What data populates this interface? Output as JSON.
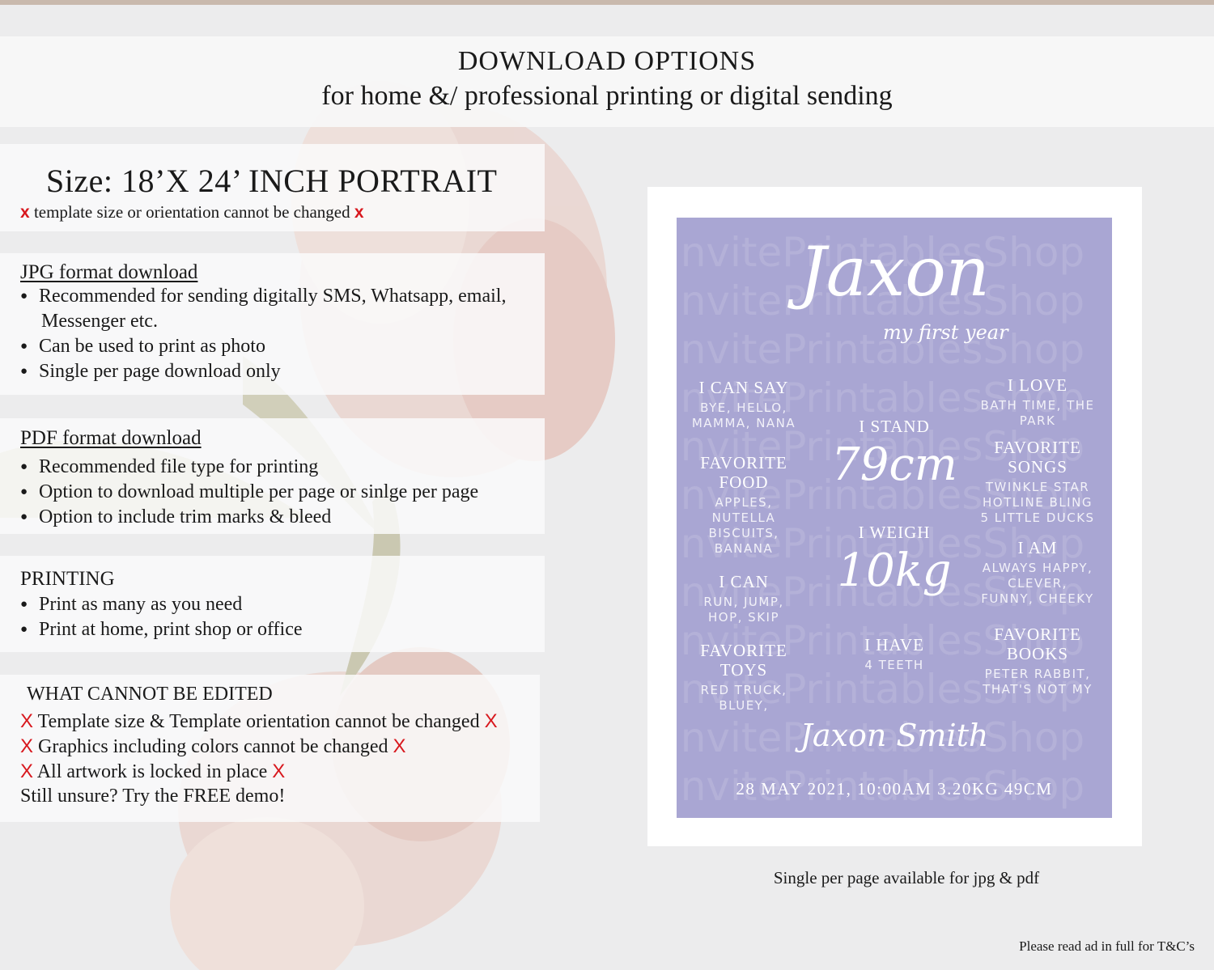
{
  "header": {
    "title": "DOWNLOAD OPTIONS",
    "subtitle": "for home &/ professional printing or digital sending"
  },
  "size_panel": {
    "title": "Size: 18’X 24’ INCH PORTRAIT",
    "x_mark": "x",
    "note": "template size or orientation cannot be changed"
  },
  "jpg_panel": {
    "title": "JPG format download",
    "bullet_1_line1": "Recommended for sending digitally SMS, Whatsapp, email,",
    "bullet_1_line2": "Messenger etc.",
    "bullet_2": "Can be used to print as photo",
    "bullet_3": "Single per page download only"
  },
  "pdf_panel": {
    "title": "PDF format download",
    "bullet_1": "Recommended file type for printing",
    "bullet_2": "Option to download multiple per page or sinlge per page",
    "bullet_3": "Option to include trim marks & bleed"
  },
  "printing_panel": {
    "title": "PRINTING",
    "bullet_1": "Print as many as you need",
    "bullet_2": "Print at home, print shop or office"
  },
  "edit_panel": {
    "title": "WHAT CANNOT BE EDITED",
    "x_mark": "X",
    "line_1": "Template size & Template orientation cannot be changed",
    "line_2": "Graphics including colors cannot be changed",
    "line_3": "All artwork is locked in place",
    "line_4": "Still unsure? Try the FREE demo!"
  },
  "poster": {
    "watermark": "InvitePrintablesShop",
    "name": "Jaxon",
    "subtitle": "my first year",
    "i_can_say_title": "I CAN SAY",
    "i_can_say_line1": "BYE, HELLO,",
    "i_can_say_line2": "MAMMA, NANA",
    "fav_food_title1": "FAVORITE",
    "fav_food_title2": "FOOD",
    "fav_food_line1": "APPLES,",
    "fav_food_line2": "NUTELLA",
    "fav_food_line3": "BISCUITS,",
    "fav_food_line4": "BANANA",
    "i_can_title": "I CAN",
    "i_can_line1": "RUN, JUMP,",
    "i_can_line2": "HOP, SKIP",
    "fav_toys_title1": "FAVORITE",
    "fav_toys_title2": "TOYS",
    "fav_toys_line1": "RED TRUCK,",
    "fav_toys_line2": "BLUEY,",
    "i_stand_title": "I STAND",
    "i_stand_value": "79cm",
    "i_weigh_title": "I WEIGH",
    "i_weigh_value": "10kg",
    "i_have_title": "I HAVE",
    "i_have_value": "4 TEETH",
    "i_love_title": "I LOVE",
    "i_love_line1": "BATH TIME, THE",
    "i_love_line2": "PARK",
    "fav_songs_title1": "FAVORITE",
    "fav_songs_title2": "SONGS",
    "fav_songs_line1": "TWINKLE STAR",
    "fav_songs_line2": "HOTLINE BLING",
    "fav_songs_line3": "5 LITTLE DUCKS",
    "i_am_title": "I AM",
    "i_am_line1": "ALWAYS HAPPY,",
    "i_am_line2": "CLEVER,",
    "i_am_line3": "FUNNY, CHEEKY",
    "fav_books_title1": "FAVORITE",
    "fav_books_title2": "BOOKS",
    "fav_books_line1": "PETER RABBIT,",
    "fav_books_line2": "THAT'S NOT MY",
    "signature": "Jaxon Smith",
    "footer": "28 MAY 2021, 10:00AM 3.20KG 49CM"
  },
  "caption": "Single per page available for jpg & pdf",
  "terms": "Please read ad in full for T&C’s",
  "colors": {
    "background": "#ececed",
    "poster": "#a9a6d3",
    "red_x": "#d8181e",
    "flower": "#e8c8c0"
  }
}
